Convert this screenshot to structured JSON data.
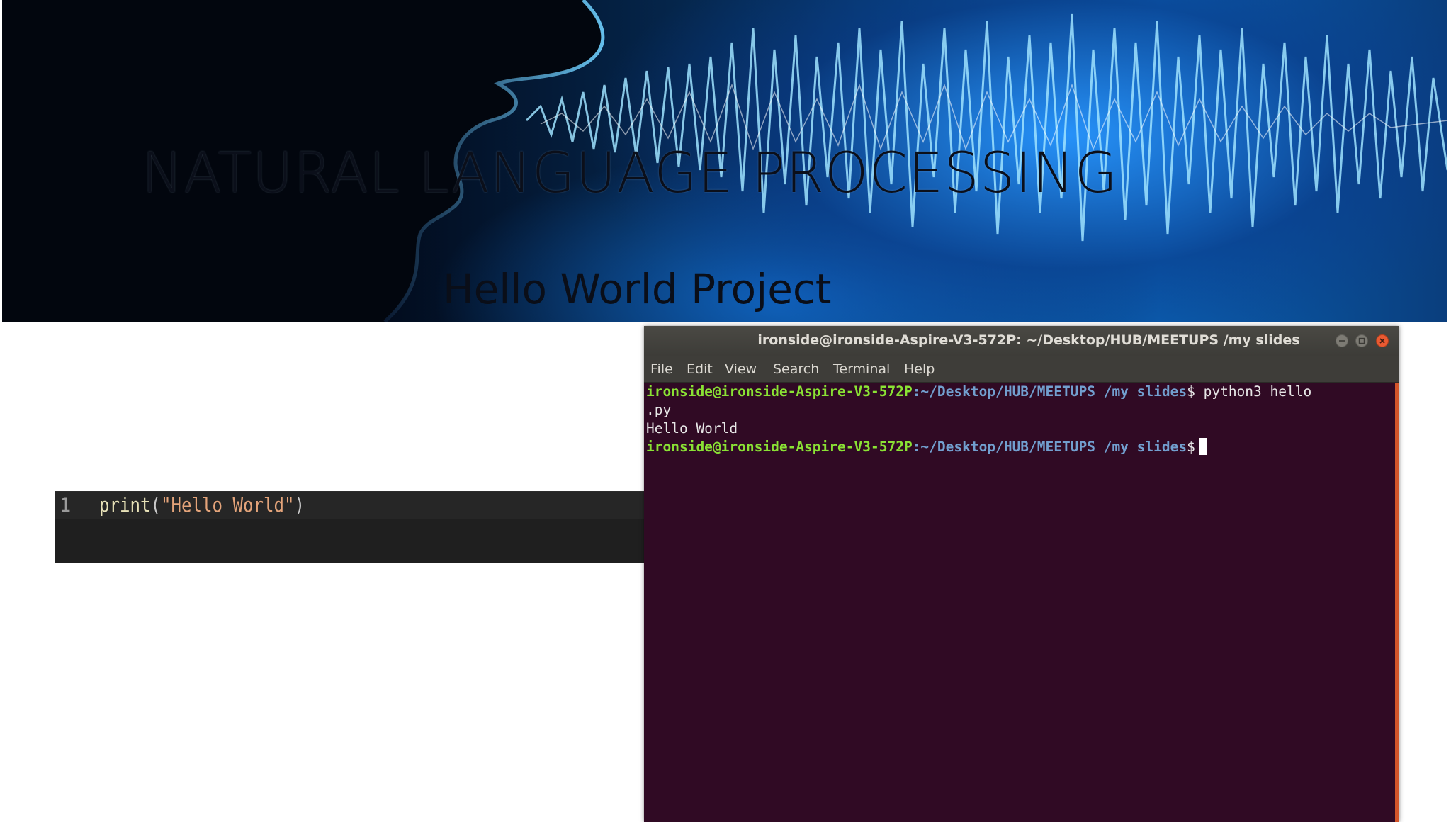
{
  "slide": {
    "title": "NATURAL LANGUAGE PROCESSING",
    "subtitle": "Hello World Project"
  },
  "editor": {
    "line_number": "1",
    "code_fn": "print",
    "code_open": "(",
    "code_str": "\"Hello World\"",
    "code_close": ")"
  },
  "terminal": {
    "title": "ironside@ironside-Aspire-V3-572P: ~/Desktop/HUB/MEETUPS /my slides",
    "menu": [
      "File",
      "Edit",
      "View",
      "Search",
      "Terminal",
      "Help"
    ],
    "prompt_user": "ironside@ironside-Aspire-V3-572P",
    "prompt_path": ":~/Desktop/HUB/MEETUPS /my slides",
    "prompt_symbol": "$",
    "command_line1": " python3 hello",
    "command_line2": ".py",
    "output": "Hello World",
    "colors": {
      "background": "#300a24",
      "user": "#8ae234",
      "path": "#729fcf"
    }
  }
}
